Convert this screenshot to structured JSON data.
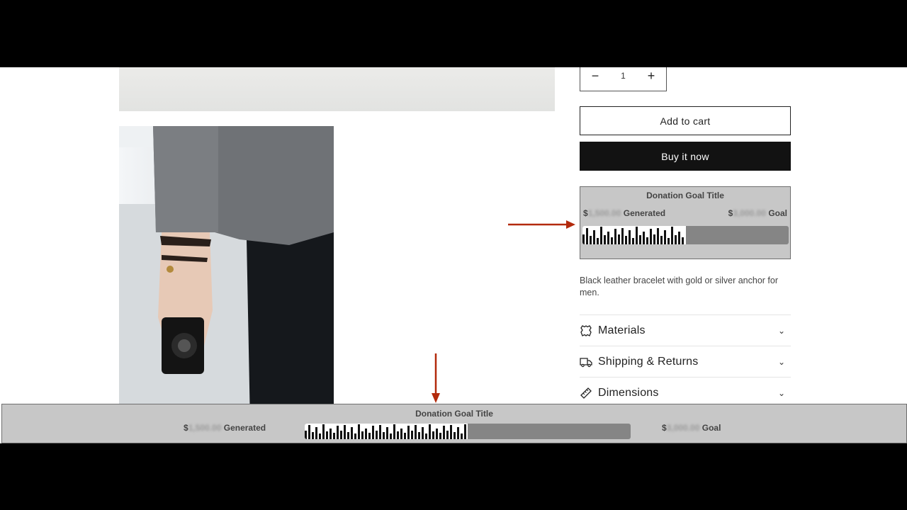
{
  "product": {
    "quantity": {
      "minus": "−",
      "value": "1",
      "plus": "+"
    },
    "add_to_cart": "Add to cart",
    "buy_now": "Buy it now",
    "description": "Black leather bracelet with gold or silver anchor for men."
  },
  "donation_goal": {
    "title": "Donation Goal Title",
    "currency": "$",
    "generated_amount": "1,500.00",
    "generated_label": "Generated",
    "goal_amount": "3,000.00",
    "goal_label": "Goal",
    "progress_fraction": 0.5
  },
  "accordion": [
    {
      "label": "Materials",
      "icon": "leather-icon"
    },
    {
      "label": "Shipping & Returns",
      "icon": "truck-icon"
    },
    {
      "label": "Dimensions",
      "icon": "ruler-icon"
    }
  ],
  "colors": {
    "annotation_arrow": "#b32a0c",
    "bar_track": "#858585",
    "goal_background": "#c7c7c7"
  }
}
